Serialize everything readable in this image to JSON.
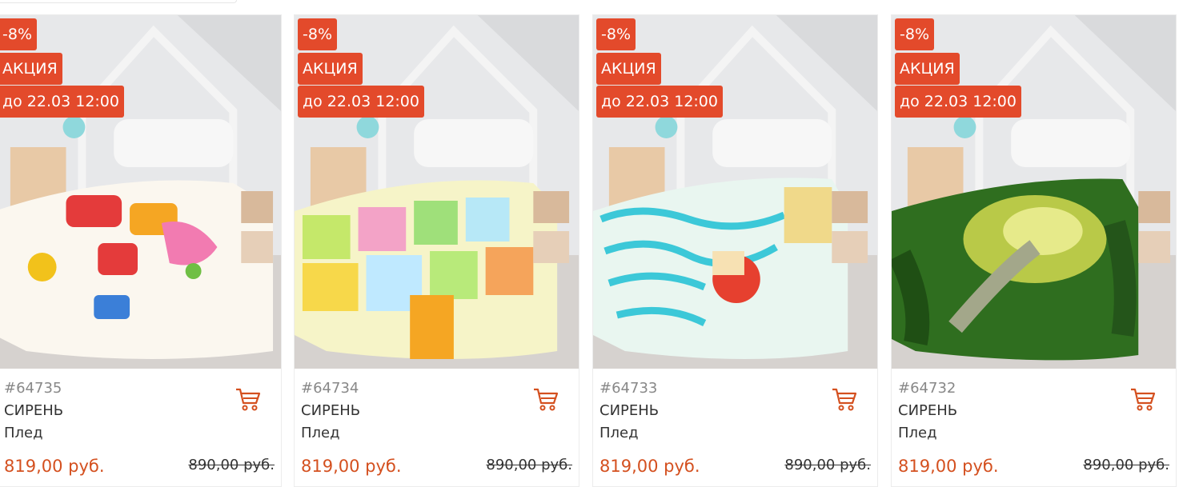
{
  "products": [
    {
      "sku": "#64735",
      "brand": "СИРЕНЬ",
      "type": "Плед",
      "price": "819,00 руб.",
      "old_price": "890,00 руб.",
      "discount": "-8%",
      "promo": "АКЦИЯ",
      "until": "до 22.03 12:00",
      "quilt": "alphabet-red",
      "accent": "#e74c3c"
    },
    {
      "sku": "#64734",
      "brand": "СИРЕНЬ",
      "type": "Плед",
      "price": "819,00 руб.",
      "old_price": "890,00 руб.",
      "discount": "-8%",
      "promo": "АКЦИЯ",
      "until": "до 22.03 12:00",
      "quilt": "animal-alphabet",
      "accent": "#8fd14f"
    },
    {
      "sku": "#64733",
      "brand": "СИРЕНЬ",
      "type": "Плед",
      "price": "819,00 руб.",
      "old_price": "890,00 руб.",
      "discount": "-8%",
      "promo": "АКЦИЯ",
      "until": "до 22.03 12:00",
      "quilt": "pirate-maze",
      "accent": "#3cc8d8"
    },
    {
      "sku": "#64732",
      "brand": "СИРЕНЬ",
      "type": "Плед",
      "price": "819,00 руб.",
      "old_price": "890,00 руб.",
      "discount": "-8%",
      "promo": "АКЦИЯ",
      "until": "до 22.03 12:00",
      "quilt": "forest-path",
      "accent": "#3f8f2a"
    }
  ],
  "colors": {
    "badge": "#e34a2b",
    "price": "#d4501f",
    "cart_icon": "#d4501f"
  },
  "icons": {
    "cart": "shopping-cart-icon"
  }
}
